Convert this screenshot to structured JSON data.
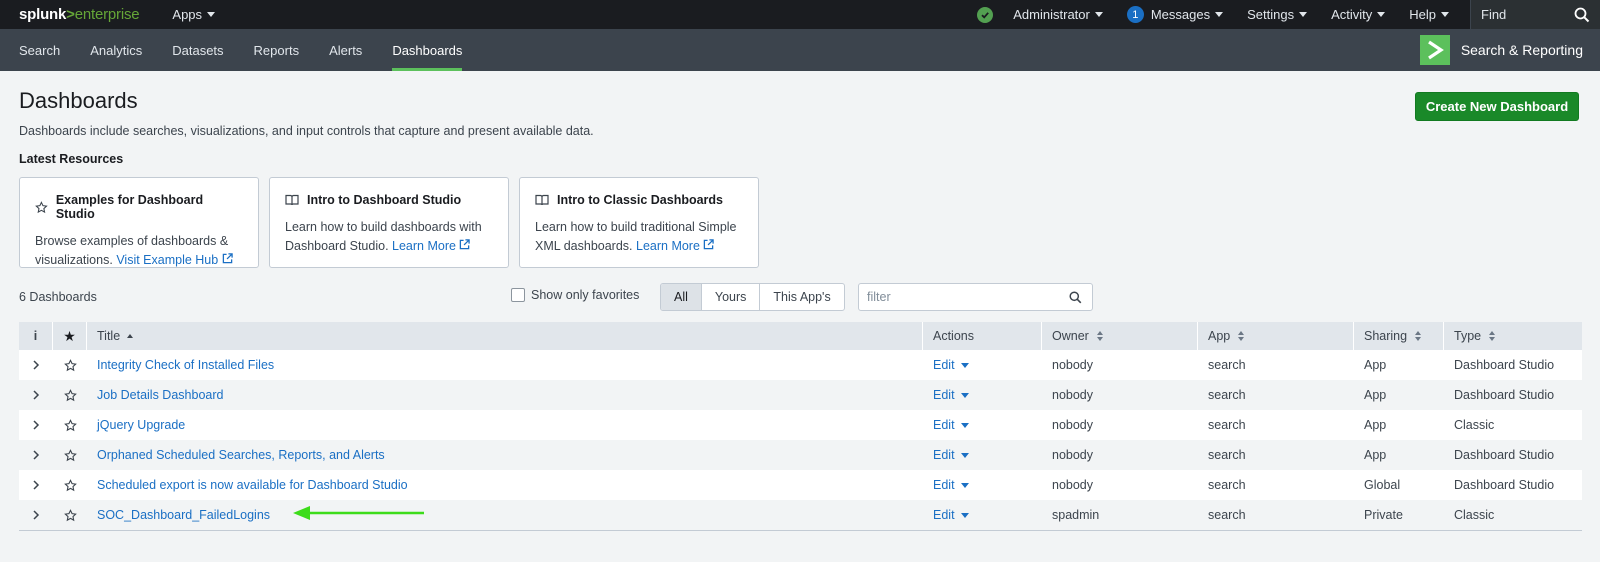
{
  "topbar": {
    "logo_main": "splunk",
    "logo_sep": ">",
    "logo_product": "enterprise",
    "apps_label": "Apps",
    "user_label": "Administrator",
    "messages_count": "1",
    "messages_label": "Messages",
    "settings_label": "Settings",
    "activity_label": "Activity",
    "help_label": "Help",
    "find_label": "Find"
  },
  "appbar": {
    "items": [
      "Search",
      "Analytics",
      "Datasets",
      "Reports",
      "Alerts",
      "Dashboards"
    ],
    "active": "Dashboards",
    "app_name": "Search & Reporting"
  },
  "page": {
    "title": "Dashboards",
    "description": "Dashboards include searches, visualizations, and input controls that capture and present available data.",
    "create_button": "Create New Dashboard",
    "latest_resources_label": "Latest Resources"
  },
  "cards": [
    {
      "icon": "star-outline-icon",
      "title": "Examples for Dashboard Studio",
      "body": "Browse examples of dashboards & visualizations.",
      "link": "Visit Example Hub"
    },
    {
      "icon": "book-icon",
      "title": "Intro to Dashboard Studio",
      "body": "Learn how to build dashboards with Dashboard Studio.",
      "link": "Learn More"
    },
    {
      "icon": "book-icon",
      "title": "Intro to Classic Dashboards",
      "body": "Learn how to build traditional Simple XML dashboards.",
      "link": "Learn More"
    }
  ],
  "toolbar": {
    "count_label": "6 Dashboards",
    "favorites_label": "Show only favorites",
    "segments": [
      "All",
      "Yours",
      "This App's"
    ],
    "filter_placeholder": "filter"
  },
  "table": {
    "headers": {
      "info": "i",
      "fav": "★",
      "title": "Title",
      "actions": "Actions",
      "owner": "Owner",
      "app": "App",
      "sharing": "Sharing",
      "type": "Type"
    },
    "rows": [
      {
        "title": "Integrity Check of Installed Files",
        "action": "Edit",
        "owner": "nobody",
        "app": "search",
        "sharing": "App",
        "type": "Dashboard Studio"
      },
      {
        "title": "Job Details Dashboard",
        "action": "Edit",
        "owner": "nobody",
        "app": "search",
        "sharing": "App",
        "type": "Dashboard Studio"
      },
      {
        "title": "jQuery Upgrade",
        "action": "Edit",
        "owner": "nobody",
        "app": "search",
        "sharing": "App",
        "type": "Classic"
      },
      {
        "title": "Orphaned Scheduled Searches, Reports, and Alerts",
        "action": "Edit",
        "owner": "nobody",
        "app": "search",
        "sharing": "App",
        "type": "Dashboard Studio"
      },
      {
        "title": "Scheduled export is now available for Dashboard Studio",
        "action": "Edit",
        "owner": "nobody",
        "app": "search",
        "sharing": "Global",
        "type": "Dashboard Studio"
      },
      {
        "title": "SOC_Dashboard_FailedLogins",
        "action": "Edit",
        "owner": "spadmin",
        "app": "search",
        "sharing": "Private",
        "type": "Classic"
      }
    ]
  },
  "colors": {
    "topbar_bg": "#1a1c20",
    "appbar_bg": "#3c444d",
    "accent_green": "#5cc05c",
    "primary_button": "#1a8929",
    "link_blue": "#1a6fc4",
    "annotation_arrow": "#3ddc1a"
  }
}
